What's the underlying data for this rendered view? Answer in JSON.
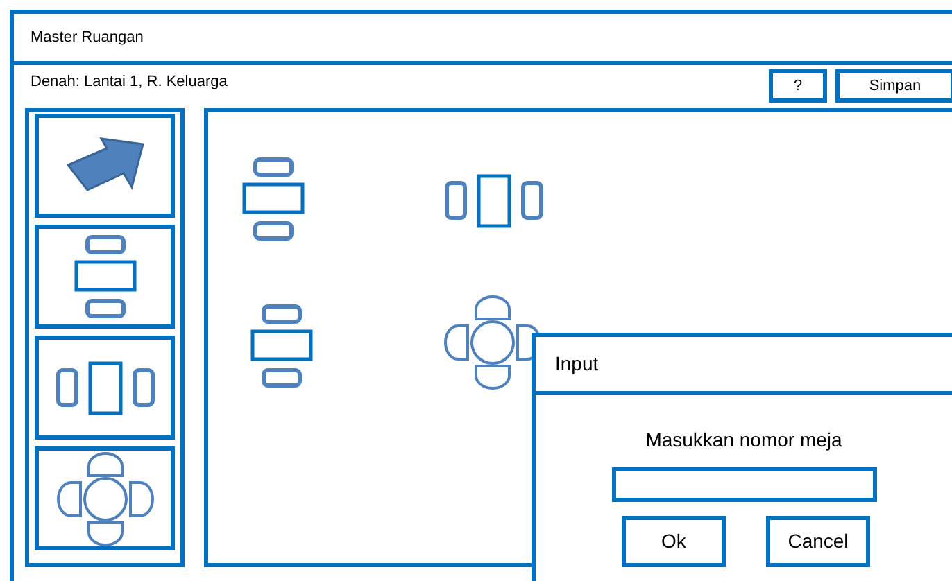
{
  "window": {
    "title": "Master Ruangan"
  },
  "toolbar": {
    "plan_label": "Denah: Lantai 1, R. Keluarga",
    "buttons": [
      {
        "label": "?"
      },
      {
        "label": "Simpan"
      }
    ]
  },
  "palette": [
    {
      "kind": "pointer"
    },
    {
      "kind": "table_vertical"
    },
    {
      "kind": "table_horizontal"
    },
    {
      "kind": "table_round"
    }
  ],
  "canvas": {
    "tables": [
      {
        "kind": "table_vertical"
      },
      {
        "kind": "table_horizontal"
      },
      {
        "kind": "table_vertical"
      },
      {
        "kind": "table_round"
      }
    ]
  },
  "dialog": {
    "title": "Input",
    "prompt": "Masukkan nomor meja",
    "buttons": [
      {
        "label": "Ok"
      },
      {
        "label": "Cancel"
      }
    ]
  }
}
